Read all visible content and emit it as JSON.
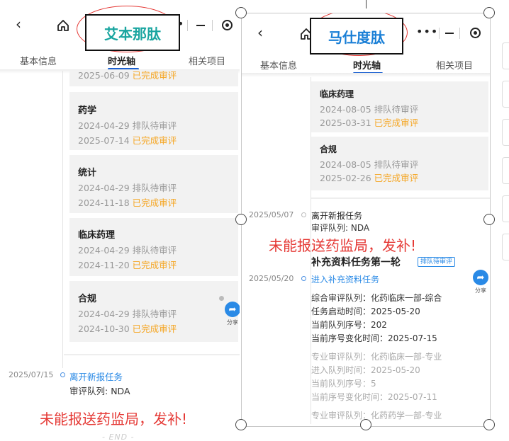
{
  "left": {
    "title": "艾本那肽",
    "tabs": [
      "基本信息",
      "时光轴",
      "相关项目"
    ],
    "top_partial": {
      "date": "2025-06-09",
      "status": "已完成审评"
    },
    "cards": [
      {
        "name": "药学",
        "queued_date": "2024-04-29",
        "queued_status": "排队待审评",
        "done_date": "2025-07-14",
        "done_status": "已完成审评"
      },
      {
        "name": "统计",
        "queued_date": "2024-04-29",
        "queued_status": "排队待审评",
        "done_date": "2024-11-18",
        "done_status": "已完成审评"
      },
      {
        "name": "临床药理",
        "queued_date": "2024-04-29",
        "queued_status": "排队待审评",
        "done_date": "2024-11-20",
        "done_status": "已完成审评"
      },
      {
        "name": "合规",
        "queued_date": "2024-04-29",
        "queued_status": "排队待审评",
        "done_date": "2024-10-30",
        "done_status": "已完成审评"
      }
    ],
    "event": {
      "date": "2025/07/15",
      "title": "离开新报任务",
      "queue_label": "审评队列:",
      "queue_value": "NDA"
    },
    "note": "未能报送药监局，发补!",
    "end": "- END -",
    "share": "分享"
  },
  "right": {
    "title": "马仕度肽",
    "tabs": [
      "基本信息",
      "时光轴",
      "相关项目"
    ],
    "cards": [
      {
        "name": "临床药理",
        "queued_date": "2024-08-05",
        "queued_status": "排队待审评",
        "done_date": "2025-03-31",
        "done_status": "已完成审评"
      },
      {
        "name": "合规",
        "queued_date": "2024-08-05",
        "queued_status": "排队待审评",
        "done_date": "2025-02-26",
        "done_status": "已完成审评"
      }
    ],
    "event1": {
      "date": "2025/05/07",
      "title": "离开新报任务",
      "queue_label": "审评队列:",
      "queue_value": "NDA"
    },
    "note": "未能报送药监局，发补!",
    "section": {
      "title": "补充资料任务第一轮",
      "badge": "排队待审评"
    },
    "event2": {
      "date": "2025/05/20",
      "title": "进入补充资料任务"
    },
    "details": [
      "综合审评队列：化药临床一部-综合",
      "任务启动时间：2025-05-20",
      "当前队列序号：202",
      "当前序号变化时间：2025-07-15"
    ],
    "details_grey": [
      "专业审评队列：化药临床一部-专业",
      "进入队列时间：2025-05-20",
      "当前队列序号：5",
      "当前序号变化时间：2025-07-11",
      "专业审评队列：化药药学一部-专业"
    ],
    "share": "分享"
  }
}
